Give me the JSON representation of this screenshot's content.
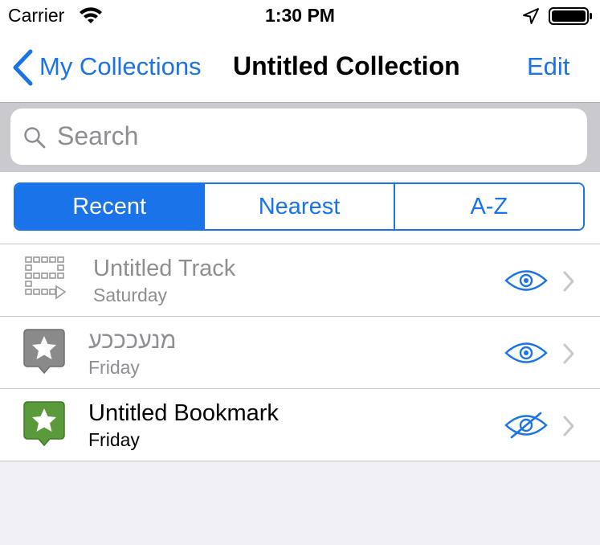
{
  "status_bar": {
    "carrier": "Carrier",
    "time": "1:30 PM"
  },
  "nav": {
    "back_label": "My Collections",
    "title": "Untitled Collection",
    "edit_label": "Edit"
  },
  "search": {
    "placeholder": "Search"
  },
  "segments": {
    "items": [
      "Recent",
      "Nearest",
      "A-Z"
    ],
    "selected": "Recent"
  },
  "list": {
    "items": [
      {
        "title": "Untitled Track",
        "subtitle": "Saturday",
        "icon": "track-icon",
        "visible": true
      },
      {
        "title": "מנעכככע",
        "subtitle": "Friday",
        "icon": "star-bookmark-icon",
        "visible": true
      },
      {
        "title": "Untitled Bookmark",
        "subtitle": "Friday",
        "icon": "star-bookmark-icon",
        "visible": false
      }
    ]
  },
  "colors": {
    "accent": "#1a73e8",
    "bookmark_green": "#5a9a3a",
    "dim_gray": "#8e8e93"
  }
}
